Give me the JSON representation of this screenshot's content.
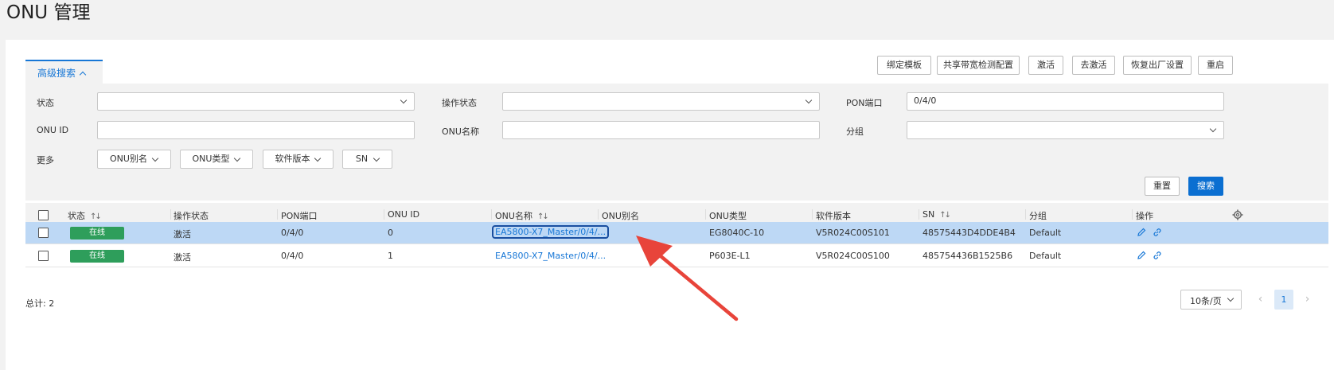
{
  "page_title": "ONU 管理",
  "adv_search_tab": "高级搜索",
  "toolbar": {
    "bind_template": "绑定模板",
    "shared_bw_config": "共享带宽检测配置",
    "activate": "激活",
    "deactivate": "去激活",
    "factory_reset": "恢复出厂设置",
    "restart": "重启"
  },
  "filters": {
    "status_label": "状态",
    "status_value": "",
    "op_status_label": "操作状态",
    "op_status_value": "",
    "pon_port_label": "PON端口",
    "pon_port_value": "0/4/0",
    "onu_id_label": "ONU ID",
    "onu_id_value": "",
    "onu_name_label": "ONU名称",
    "onu_name_value": "",
    "group_label": "分组",
    "group_value": "",
    "more_label": "更多",
    "chips": [
      "ONU别名",
      "ONU类型",
      "软件版本",
      "SN"
    ],
    "reset_label": "重置",
    "search_label": "搜索"
  },
  "table": {
    "headers": [
      "状态",
      "操作状态",
      "PON端口",
      "ONU ID",
      "ONU名称",
      "ONU别名",
      "ONU类型",
      "软件版本",
      "SN",
      "分组",
      "操作"
    ],
    "rows": [
      {
        "status": "在线",
        "op_status": "激活",
        "pon_port": "0/4/0",
        "onu_id": "0",
        "onu_name": "EA5800-X7_Master/0/4/...",
        "alias": "",
        "type": "EG8040C-10",
        "software": "V5R024C00S101",
        "sn": "48575443D4DDE4B4",
        "group": "Default"
      },
      {
        "status": "在线",
        "op_status": "激活",
        "pon_port": "0/4/0",
        "onu_id": "1",
        "onu_name": "EA5800-X7_Master/0/4/...",
        "alias": "",
        "type": "P603E-L1",
        "software": "V5R024C00S100",
        "sn": "485754436B1525B6",
        "group": "Default"
      }
    ]
  },
  "footer": {
    "total": "总计: 2",
    "page_size": "10条/页",
    "current_page": "1"
  },
  "colors": {
    "accent": "#1777d6",
    "online_badge": "#2e9e5b",
    "selected_row": "#bdd8f5",
    "annotation_arrow": "#e8443a"
  },
  "annotation": {
    "type": "red-arrow"
  }
}
